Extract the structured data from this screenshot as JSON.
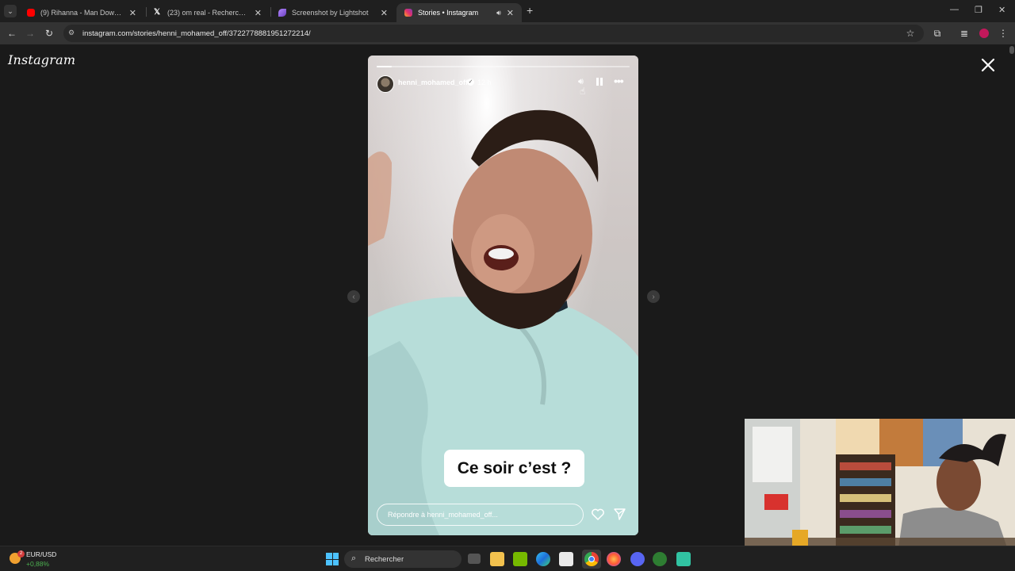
{
  "browser": {
    "tabs": [
      {
        "title": "(9) Rihanna - Man Down (Demo",
        "favicon": "youtube-icon",
        "color": "#ff0000",
        "active": false
      },
      {
        "title": "(23) om real - Recherche / X",
        "favicon": "x-icon",
        "color": "#ffffff",
        "active": false
      },
      {
        "title": "Screenshot by Lightshot",
        "favicon": "lightshot-feather-icon",
        "color": "#9b6bd6",
        "active": false
      },
      {
        "title": "Stories • Instagram",
        "favicon": "instagram-icon",
        "color": "#e1306c",
        "active": true
      }
    ],
    "url": "instagram.com/stories/henni_mohamed_off/3722778881951272214/"
  },
  "page": {
    "logo": "Instagram",
    "story": {
      "username": "henni_mohamed_off",
      "age": "12 h",
      "caption": "Ce soir c’est ?",
      "reply_placeholder": "Répondre à henni_mohamed_off...",
      "progress": 0.06
    }
  },
  "taskbar": {
    "widget_label": "EUR/USD",
    "widget_value": "+0,88%",
    "widget_badge": "2",
    "search_placeholder": "Rechercher"
  },
  "colors": {
    "chrome_bg": "#1f1f1f",
    "toolbar_bg": "#333333",
    "page_bg": "#1a1a1a",
    "positive": "#4caf50"
  }
}
